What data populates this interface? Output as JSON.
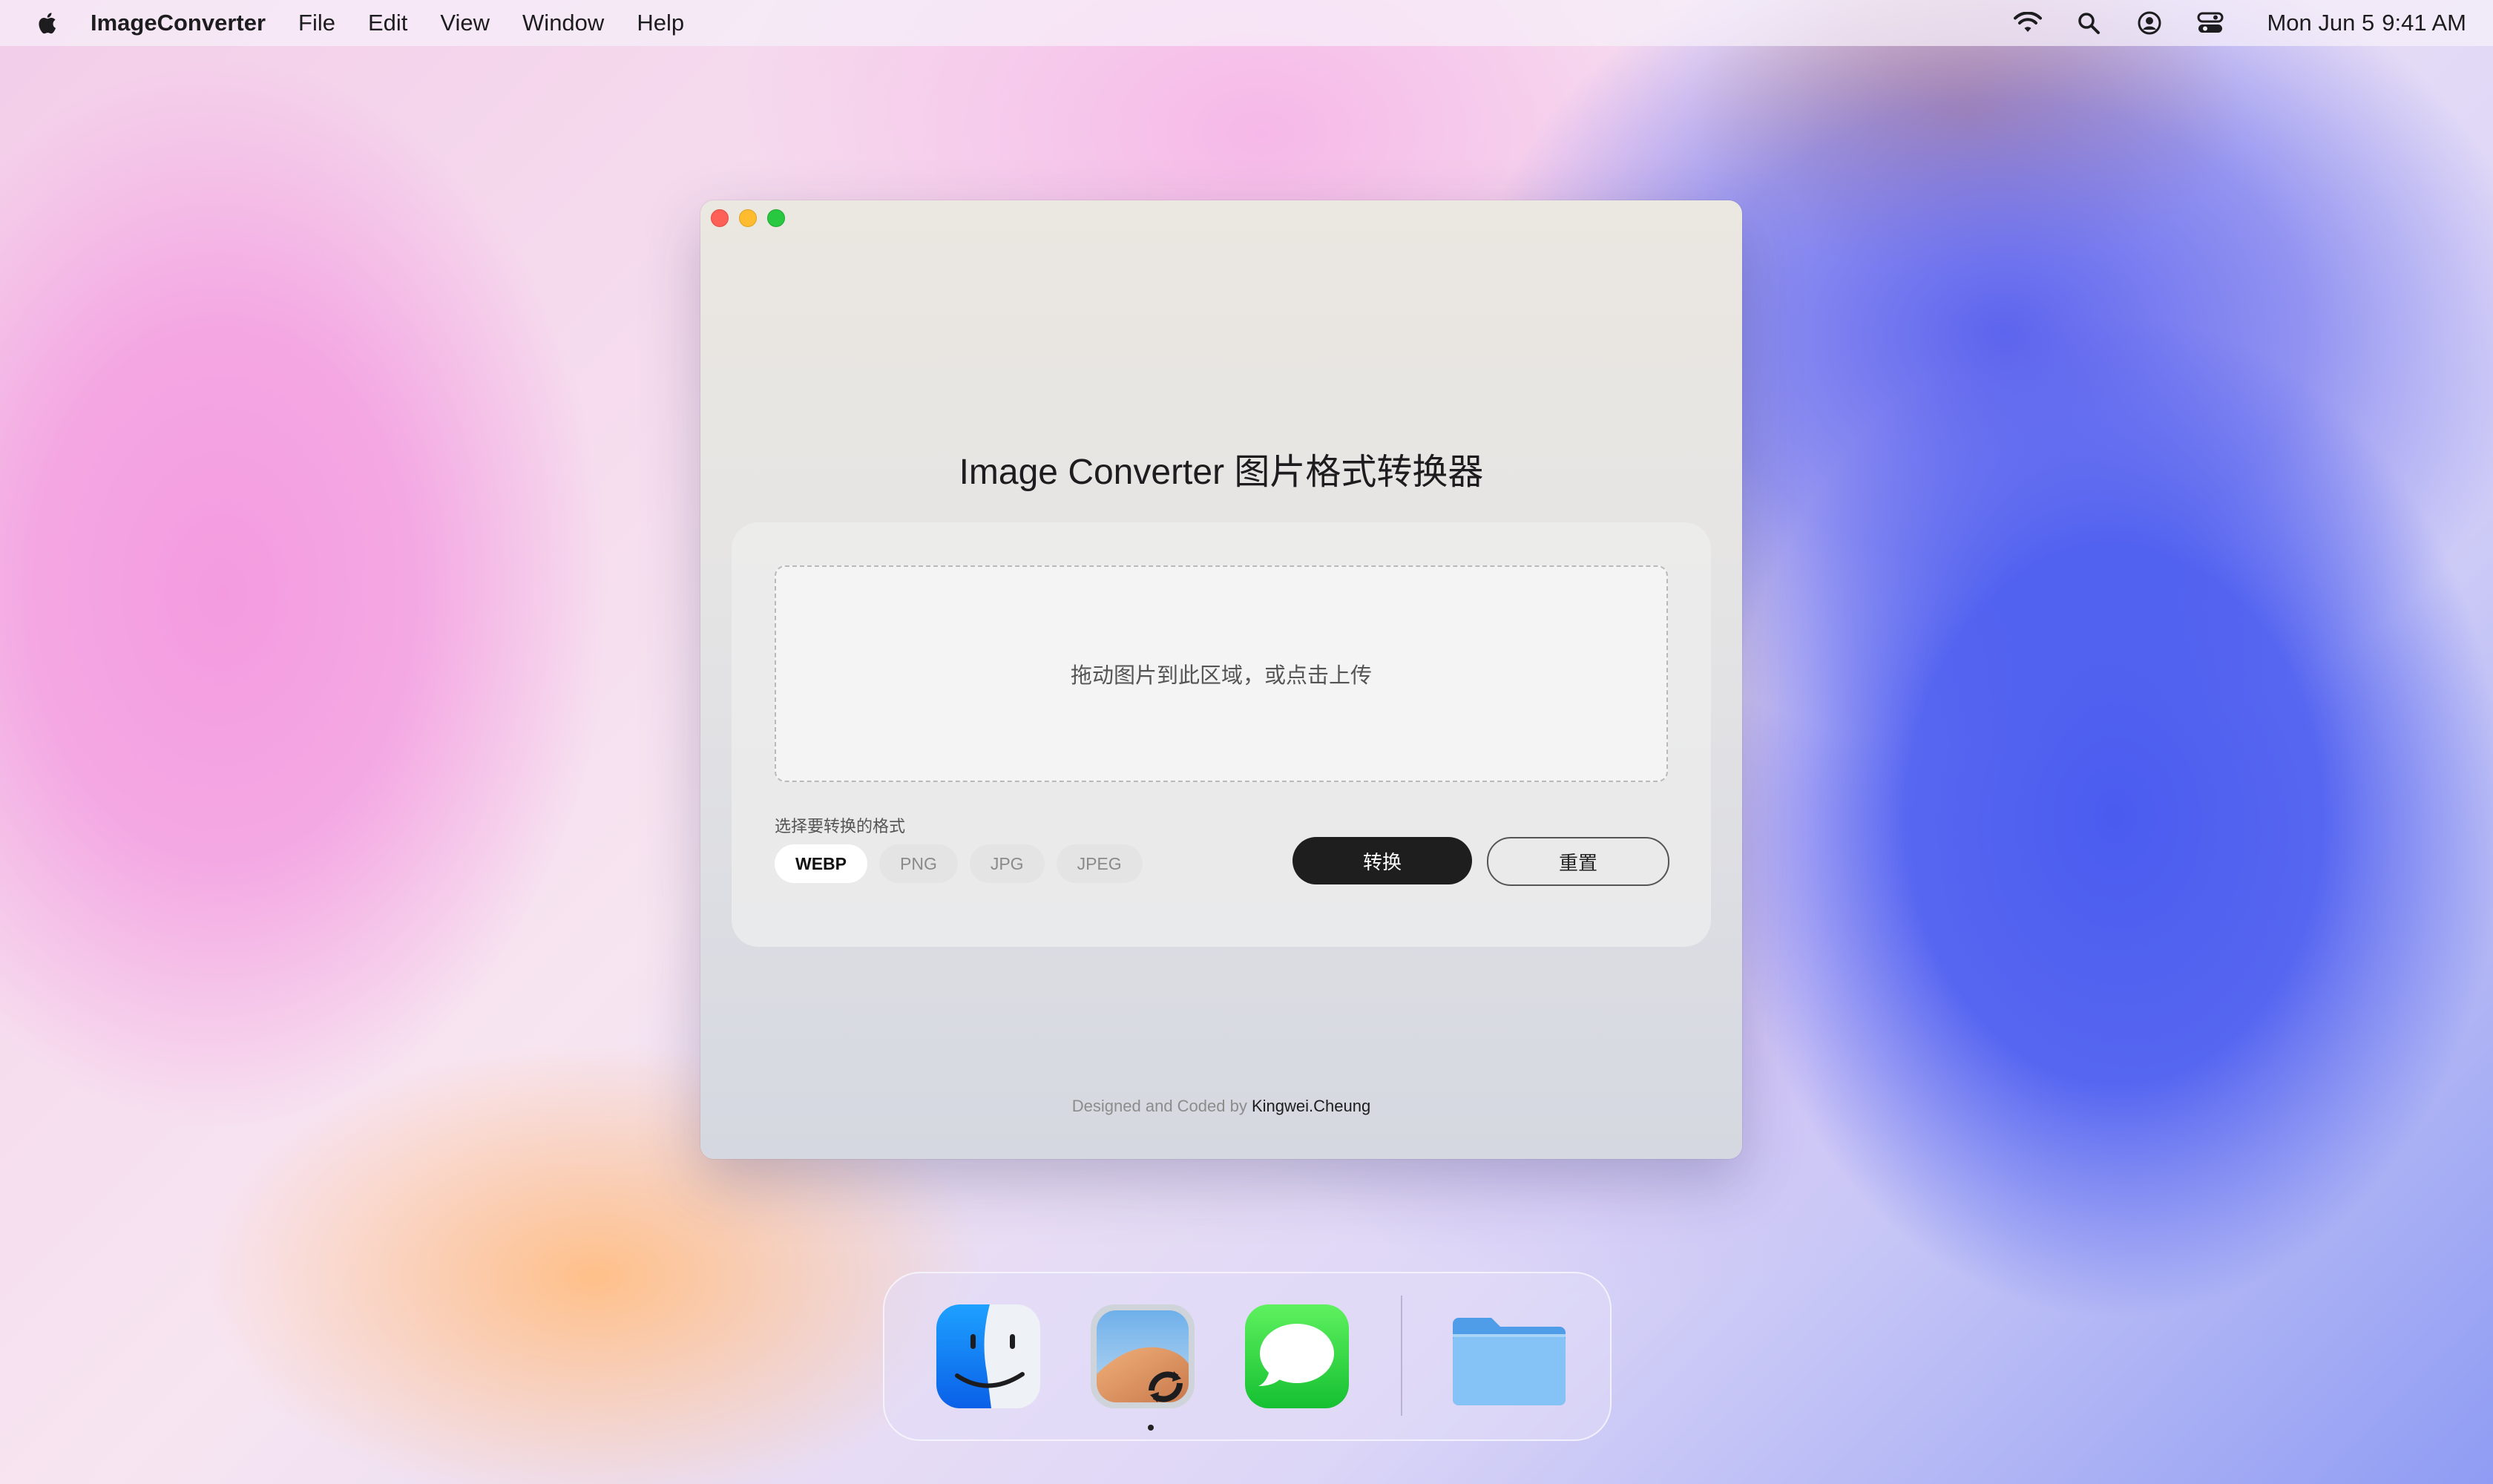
{
  "menubar": {
    "app_name": "ImageConverter",
    "items": [
      "File",
      "Edit",
      "View",
      "Window",
      "Help"
    ],
    "date": "Mon Jun 5",
    "time": "9:41 AM"
  },
  "window": {
    "title": "Image Converter 图片格式转换器",
    "dropzone_text": "拖动图片到此区域，或点击上传",
    "format_label": "选择要转换的格式",
    "formats": [
      "WEBP",
      "PNG",
      "JPG",
      "JPEG"
    ],
    "selected_format": "WEBP",
    "convert_label": "转换",
    "reset_label": "重置",
    "footer_prefix": "Designed and Coded by",
    "footer_author": "Kingwei.Cheung"
  },
  "dock": {
    "apps": [
      "finder-icon",
      "image-converter-app-icon",
      "messages-icon",
      "folder-icon"
    ],
    "running_app": "image-converter-app-icon"
  },
  "colors": {
    "traffic_close": "#fe5f57",
    "traffic_minimize": "#febc2e",
    "traffic_zoom": "#28c840",
    "primary_button": "#1e1e1e"
  }
}
